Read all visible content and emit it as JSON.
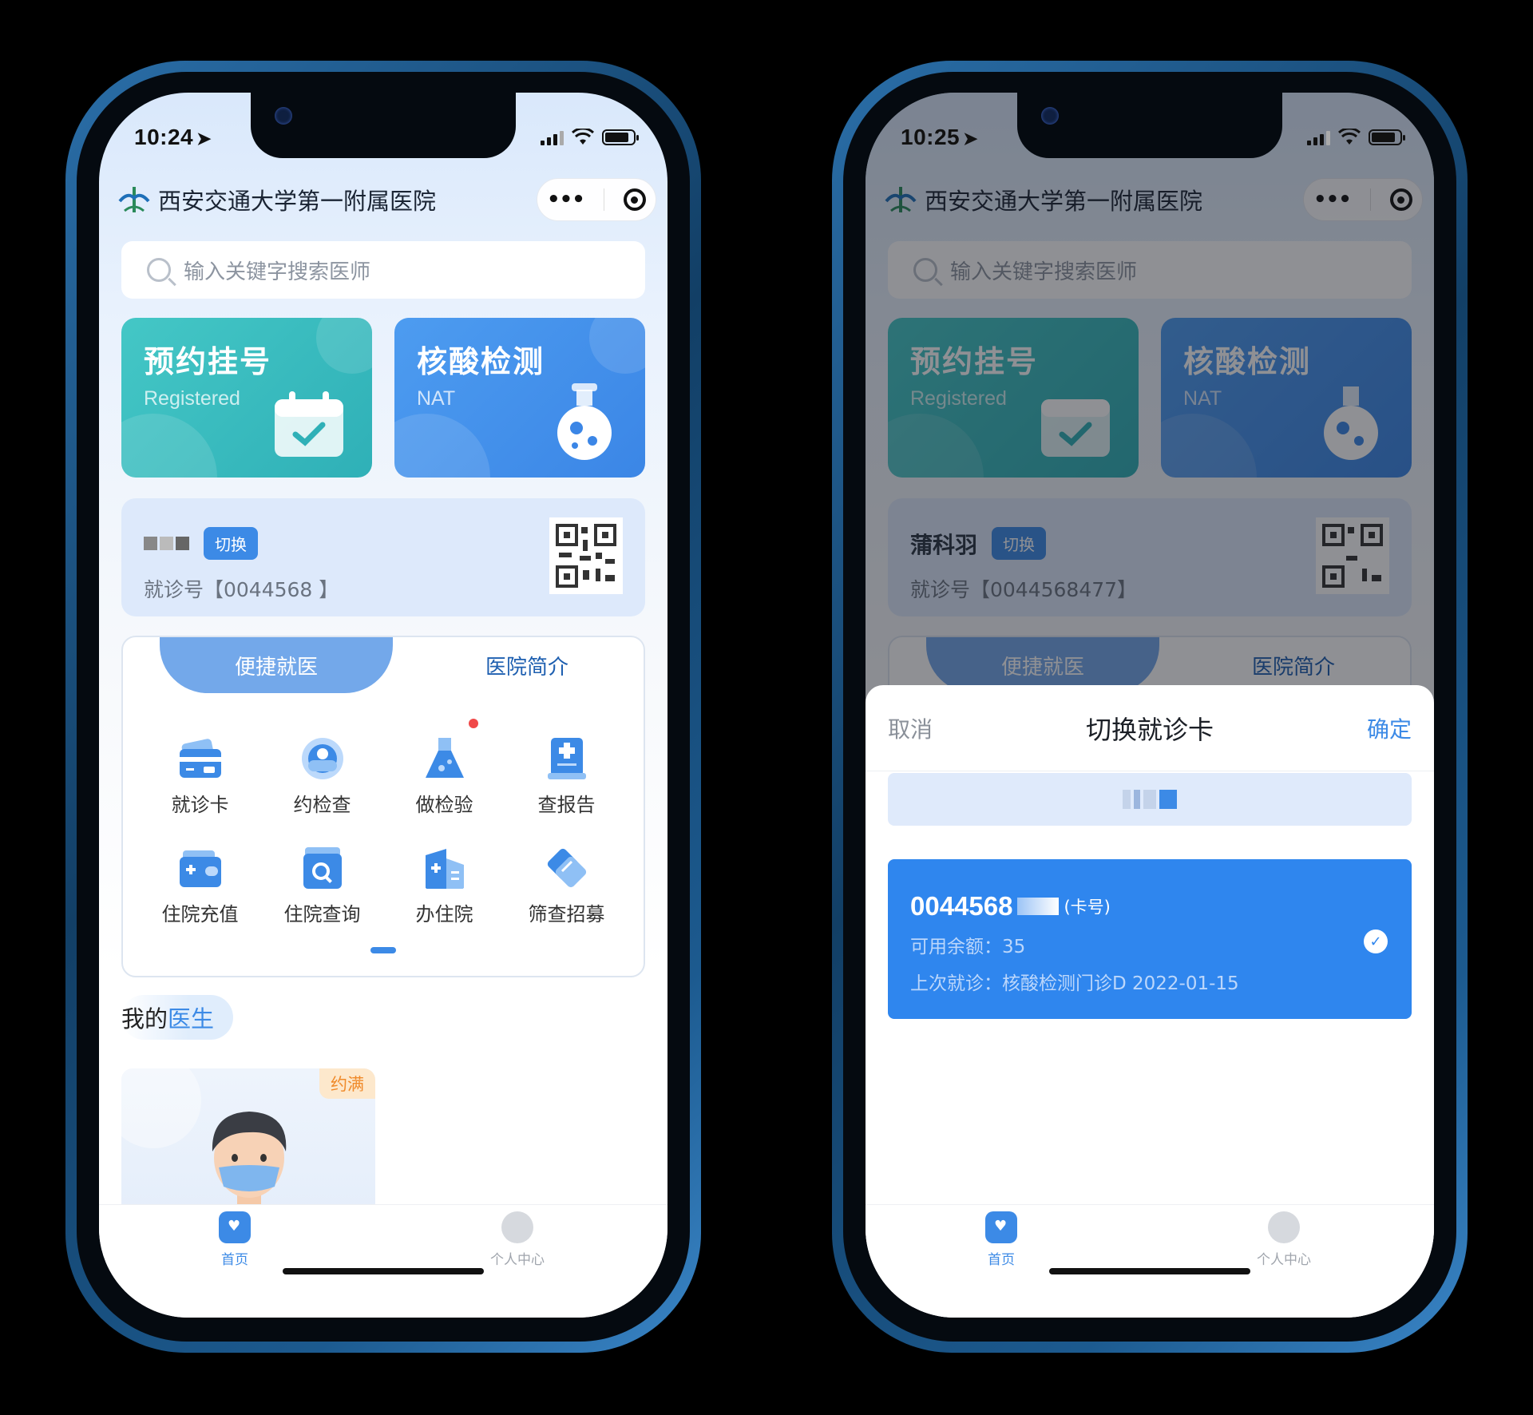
{
  "left_phone": {
    "status": {
      "time": "10:24"
    },
    "header": {
      "title": "西安交通大学第一附属医院"
    },
    "search": {
      "placeholder": "输入关键字搜索医师"
    },
    "cards": [
      {
        "title": "预约挂号",
        "subtitle": "Registered"
      },
      {
        "title": "核酸检测",
        "subtitle": "NAT"
      }
    ],
    "patient": {
      "switch_label": "切换",
      "visit_no": "就诊号【0044568  】"
    },
    "tabs": [
      "便捷就医",
      "医院简介"
    ],
    "grid": [
      {
        "label": "就诊卡",
        "icon": "card-icon"
      },
      {
        "label": "约检查",
        "icon": "exam-icon"
      },
      {
        "label": "做检验",
        "icon": "flask-icon"
      },
      {
        "label": "查报告",
        "icon": "report-icon"
      },
      {
        "label": "住院充值",
        "icon": "wallet-icon"
      },
      {
        "label": "住院查询",
        "icon": "search-box-icon"
      },
      {
        "label": "办住院",
        "icon": "hospital-icon"
      },
      {
        "label": "筛查招募",
        "icon": "handshake-icon"
      }
    ],
    "my_doctor": {
      "prefix": "我的",
      "highlight": "医生",
      "tag": "约满"
    },
    "tabbar": {
      "home": "首页",
      "me": "个人中心"
    }
  },
  "right_phone": {
    "status": {
      "time": "10:25"
    },
    "header": {
      "title": "西安交通大学第一附属医院"
    },
    "search": {
      "placeholder": "输入关键字搜索医师"
    },
    "cards": [
      {
        "title": "预约挂号",
        "subtitle": "Registered"
      },
      {
        "title": "核酸检测",
        "subtitle": "NAT"
      }
    ],
    "patient": {
      "name": "蒲科羽",
      "switch_label": "切换",
      "visit_no": "就诊号【0044568477】"
    },
    "tabs": [
      "便捷就医",
      "医院简介"
    ],
    "sheet": {
      "cancel": "取消",
      "title": "切换就诊卡",
      "confirm": "确定",
      "card_no": "0044568",
      "card_no_suffix": "(卡号)",
      "balance": "可用余额：35",
      "last_visit": "上次就诊：核酸检测门诊D 2022-01-15"
    },
    "tabbar": {
      "home": "首页",
      "me": "个人中心"
    }
  },
  "colors": {
    "accent": "#3c8ae6",
    "green_card": "#3dbdc0",
    "blue_card": "#4592ec",
    "badge": "#f08a2a"
  }
}
